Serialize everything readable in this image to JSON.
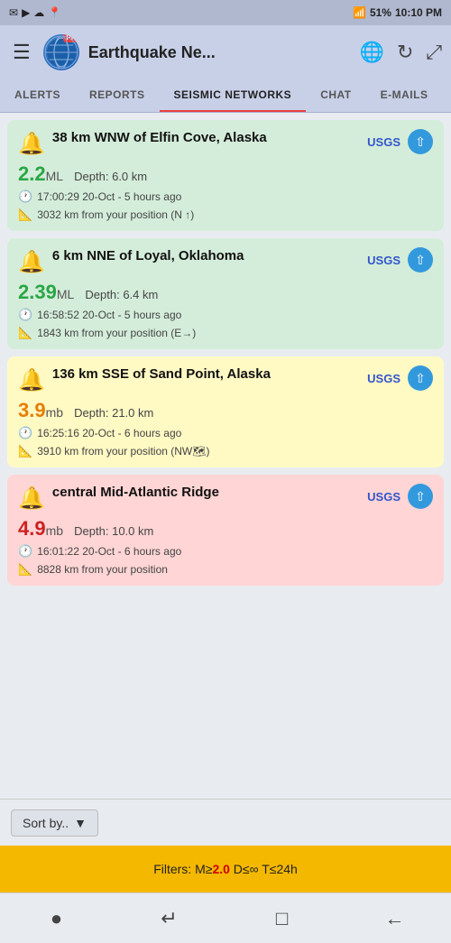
{
  "statusBar": {
    "leftIcons": [
      "✉",
      "▶",
      "☁"
    ],
    "signal": "📶",
    "battery": "51%",
    "time": "10:10 PM"
  },
  "header": {
    "title": "Earthquake Ne...",
    "menuIcon": "☰",
    "globeIcon": "🌐",
    "refreshIcon": "↻",
    "expandIcon": "⤢"
  },
  "tabs": [
    {
      "id": "alerts",
      "label": "ALERTS"
    },
    {
      "id": "reports",
      "label": "REPORTS"
    },
    {
      "id": "seismic",
      "label": "SEISMIC NETWORKS",
      "active": true
    },
    {
      "id": "chat",
      "label": "CHAT"
    },
    {
      "id": "emails",
      "label": "E-MAILS"
    }
  ],
  "earthquakes": [
    {
      "id": "eq1",
      "color": "green",
      "icon": "🔔",
      "title": "38 km WNW of Elfin Cove, Alaska",
      "source": "USGS",
      "magnitude": "2.2",
      "magnitudeUnit": "ML",
      "magnitudeColor": "green-text",
      "depth": "Depth: 6.0 km",
      "time": "17:00:29 20-Oct - 5 hours ago",
      "distance": "3032 km from your position (N ↑)"
    },
    {
      "id": "eq2",
      "color": "green",
      "icon": "🔔",
      "title": "6 km NNE of Loyal, Oklahoma",
      "source": "USGS",
      "magnitude": "2.39",
      "magnitudeUnit": "ML",
      "magnitudeColor": "green-text",
      "depth": "Depth: 6.4 km",
      "time": "16:58:52 20-Oct - 5 hours ago",
      "distance": "1843 km from your position (E→)"
    },
    {
      "id": "eq3",
      "color": "yellow",
      "icon": "🔔",
      "title": "136 km SSE of Sand Point, Alaska",
      "source": "USGS",
      "magnitude": "3.9",
      "magnitudeUnit": "mb",
      "magnitudeColor": "orange-text",
      "depth": "Depth: 21.0 km",
      "time": "16:25:16 20-Oct - 6 hours ago",
      "distance": "3910 km from your position (NW🗺)"
    },
    {
      "id": "eq4",
      "color": "pink",
      "icon": "🔔",
      "title": "central Mid-Atlantic Ridge",
      "source": "USGS",
      "magnitude": "4.9",
      "magnitudeUnit": "mb",
      "magnitudeColor": "red-text",
      "depth": "Depth: 10.0 km",
      "time": "16:01:22 20-Oct - 6 hours ago",
      "distance": "8828 km from your position"
    }
  ],
  "sortBar": {
    "label": "Sort by..",
    "chevron": "▼"
  },
  "filterBar": {
    "prefix": "Filters: M≥",
    "magnitude": "2.0",
    "suffix": " D≤∞ T≤24h"
  },
  "bottomNav": {
    "dotIcon": "●",
    "returnIcon": "↵",
    "squareIcon": "□",
    "backIcon": "←"
  }
}
